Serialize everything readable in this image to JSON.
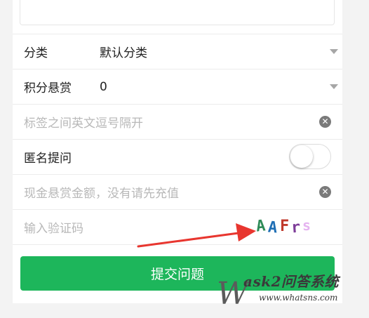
{
  "form": {
    "category": {
      "label": "分类",
      "value": "默认分类"
    },
    "reward_points": {
      "label": "积分悬赏",
      "value": "0"
    },
    "tags": {
      "placeholder": "标签之间英文逗号隔开"
    },
    "anonymous": {
      "label": "匿名提问",
      "enabled": false
    },
    "cash_reward": {
      "placeholder": "现金悬赏金额，没有请先充值"
    },
    "captcha": {
      "placeholder": "输入验证码",
      "image_text": "AAFr"
    },
    "submit_label": "提交问题"
  },
  "watermark": {
    "title": "ask2问答系统",
    "url": "www.whatsns.com"
  },
  "colors": {
    "primary_green": "#1db65b",
    "annotation_arrow": "#e8362f",
    "placeholder_gray": "#b8b8b8"
  }
}
